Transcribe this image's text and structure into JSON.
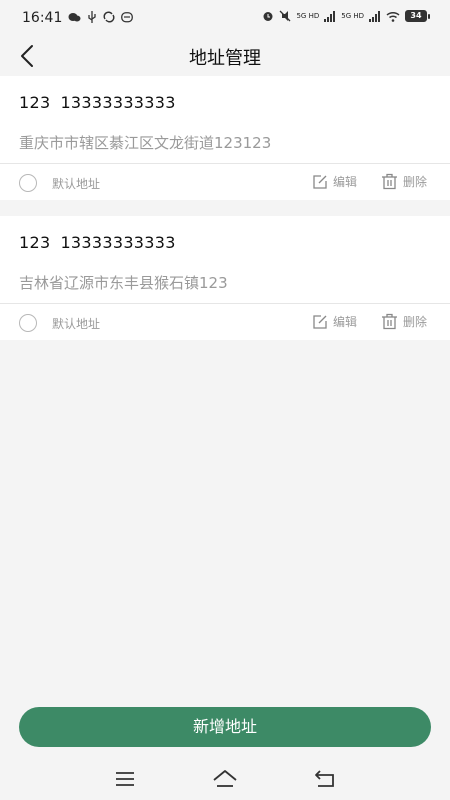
{
  "status_bar": {
    "time": "16:41",
    "network_label_1": "5G HD",
    "network_label_2": "5G HD",
    "battery": "34"
  },
  "nav": {
    "title": "地址管理"
  },
  "addresses": [
    {
      "name": "123",
      "phone": "13333333333",
      "address": "重庆市市辖区綦江区文龙街道123123",
      "default_label": "默认地址",
      "edit_label": "编辑",
      "delete_label": "删除"
    },
    {
      "name": "123",
      "phone": "13333333333",
      "address": "吉林省辽源市东丰县猴石镇123",
      "default_label": "默认地址",
      "edit_label": "编辑",
      "delete_label": "删除"
    }
  ],
  "footer": {
    "add_label": "新增地址"
  },
  "icons": {
    "back": "back-arrow-icon",
    "edit": "edit-icon",
    "delete": "trash-icon",
    "menu": "menu-icon",
    "home": "home-icon",
    "back_sys": "return-icon"
  },
  "colors": {
    "primary": "#3d8a66",
    "muted_text": "#9a9a9a",
    "background": "#f4f4f4"
  }
}
